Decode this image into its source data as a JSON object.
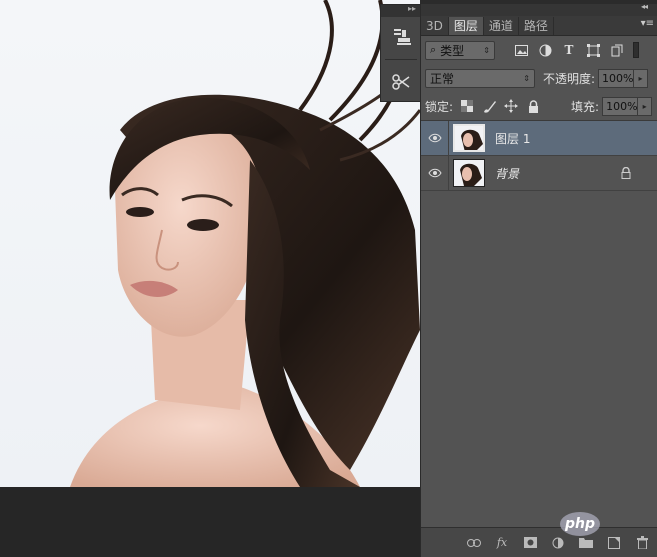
{
  "panel": {
    "tabs": [
      {
        "label": "3D"
      },
      {
        "label": "图层"
      },
      {
        "label": "通道"
      },
      {
        "label": "路径"
      }
    ],
    "filter": {
      "kind_label": "类型"
    },
    "blend": {
      "mode": "正常",
      "opacity_label": "不透明度:",
      "opacity_value": "100%"
    },
    "lock": {
      "label": "锁定:",
      "fill_label": "填充:",
      "fill_value": "100%"
    },
    "layers": [
      {
        "name": "图层 1",
        "selected": true,
        "locked": false
      },
      {
        "name": "背景",
        "selected": false,
        "locked": true
      }
    ],
    "bottom": {
      "fx_label": "fx"
    }
  },
  "watermark": {
    "text": "php"
  },
  "colors": {
    "panel_bg": "#535353",
    "selected_layer": "#5d6b7b",
    "canvas_bg": "#f2f4f7"
  }
}
